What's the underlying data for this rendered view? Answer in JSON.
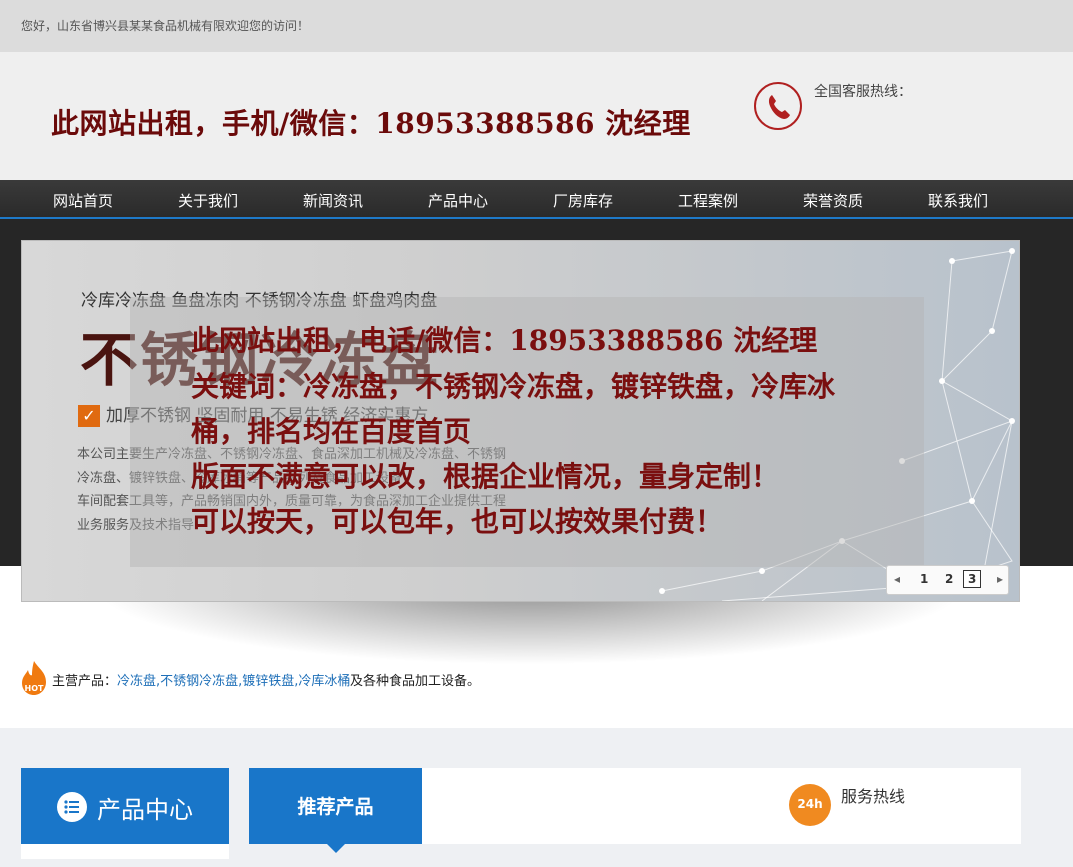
{
  "topbar": {
    "welcome": "您好，山东省博兴县某某食品机械有限欢迎您的访问！"
  },
  "header": {
    "slogan": "此网站出租，手机/微信：18953388586  沈经理",
    "hotline_label": "全国客服热线："
  },
  "nav": {
    "items": [
      "网站首页",
      "关于我们",
      "新闻资讯",
      "产品中心",
      "厂房库存",
      "工程案例",
      "荣誉资质",
      "联系我们"
    ]
  },
  "banner": {
    "tagline": "冷库冷冻盘 鱼盘冻肉 不锈钢冷冻盘 虾盘鸡肉盘",
    "big_title": "不锈钢冷冻盘",
    "feature": "加厚不锈钢  坚固耐用  不易生锈  经济实惠方",
    "desc_lines": [
      "本公司主要生产冷冻盘、不锈钢冷冻盘、食品深加工机械及冷冻盘、不锈钢",
      "冷冻盘、镀锌铁盘、冷库冰桶等产品系列及食品加工设备",
      "车间配套工具等，产品畅销国内外，质量可靠，为食品深加工企业提供工程",
      "业务服务及技术指导"
    ],
    "overlay_lines": [
      "此网站出租，电话/微信：18953388586 沈经理",
      "关键词：冷冻盘，不锈钢冷冻盘，镀锌铁盘，冷库冰",
      "桶，排名均在百度首页",
      "版面不满意可以改，根据企业情况，量身定制！",
      "可以按天，可以包年，也可以按效果付费！"
    ],
    "pager": {
      "prev": "◂",
      "pages": [
        "1",
        "2",
        "3"
      ],
      "current": "3",
      "next": "▸"
    }
  },
  "main_products": {
    "label": "主营产品：",
    "value": "冷冻盘,不锈钢冷冻盘,镀锌铁盘,冷库冰桶",
    "tail": "及各种食品加工设备。",
    "hot_badge": "HOT"
  },
  "bottom": {
    "product_center": "产品中心",
    "recommended": "推荐产品",
    "service_icon_text": "24h",
    "service_hotline": "服务热线"
  },
  "colors": {
    "accent": "#1976c9",
    "slogan": "#6b0a0a",
    "overlay_text": "#7a0f0f"
  }
}
